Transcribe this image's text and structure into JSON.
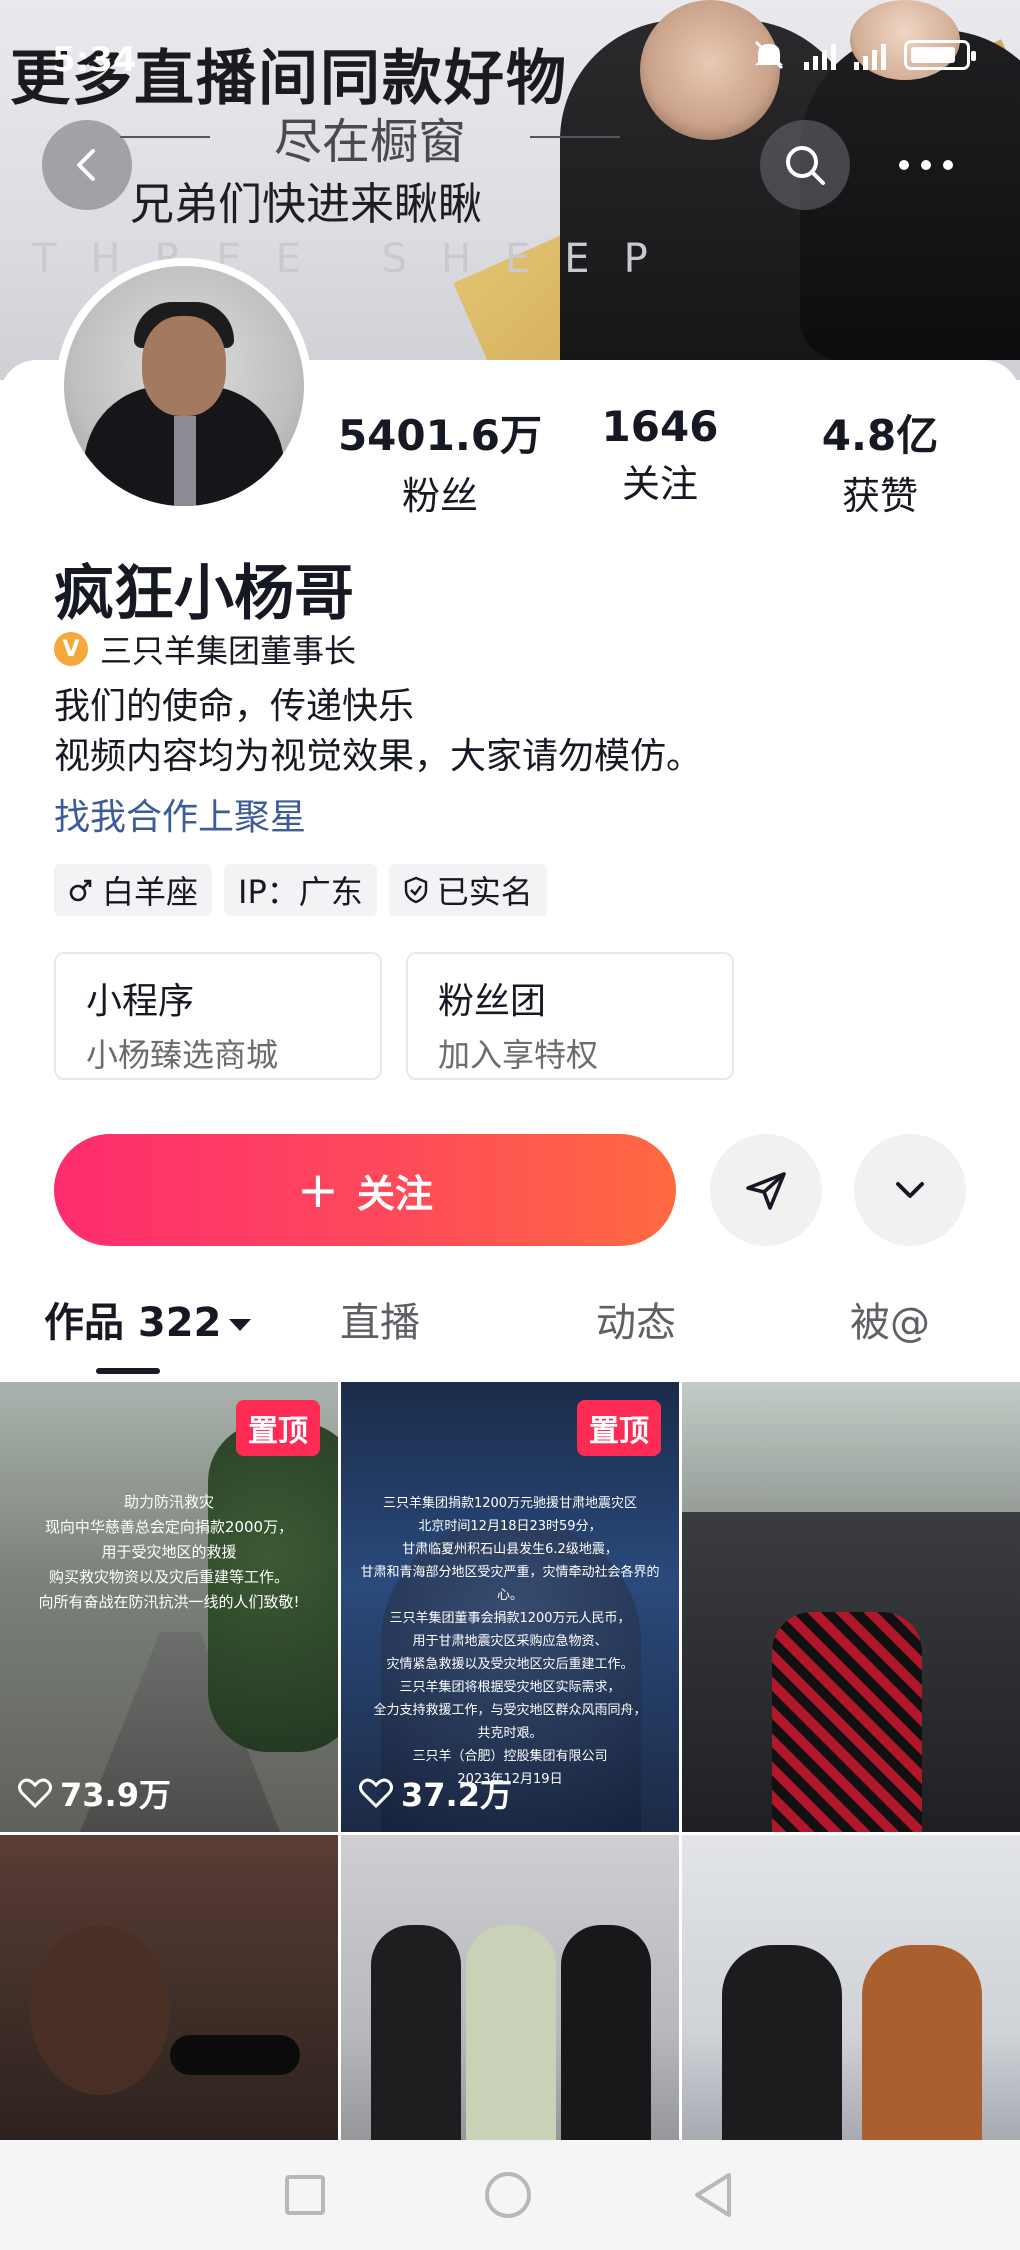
{
  "banner": {
    "headline": "更多直播间同款好物",
    "subtitle": "尽在橱窗",
    "subtitle2": "兄弟们快进来瞅瞅",
    "watermark": "THREE SHEEP"
  },
  "status_bar": {
    "time": "5:34"
  },
  "profile": {
    "stats": [
      {
        "value": "5401.6万",
        "label": "粉丝"
      },
      {
        "value": "1646",
        "label": "关注"
      },
      {
        "value": "4.8亿",
        "label": "获赞"
      }
    ],
    "name": "疯狂小杨哥",
    "verify_badge": "V",
    "verified_title": "三只羊集团董事长",
    "bio_line1": "我们的使命，传递快乐",
    "bio_line2": "视频内容均为视觉效果，大家请勿模仿。",
    "collab_link": "找我合作上聚星",
    "tags": [
      {
        "icon": "male-icon",
        "label": "白羊座"
      },
      {
        "label": "IP：广东"
      },
      {
        "icon": "shield-check-icon",
        "label": "已实名"
      }
    ],
    "mini_cards": [
      {
        "title": "小程序",
        "subtitle": "小杨臻选商城"
      },
      {
        "title": "粉丝团",
        "subtitle": "加入享特权"
      }
    ],
    "follow_plus": "+",
    "follow_label": "关注"
  },
  "tabs": [
    {
      "label": "作品 322",
      "active": true
    },
    {
      "label": "直播"
    },
    {
      "label": "动态"
    },
    {
      "label": "被@"
    }
  ],
  "grid": {
    "tiles": [
      {
        "pinned": "置顶",
        "likes": "73.9万",
        "caption": [
          "助力防汛救灾",
          "现向中华慈善总会定向捐款2000万，",
          "用于受灾地区的救援",
          "购买救灾物资以及灾后重建等工作。",
          "向所有奋战在防汛抗洪一线的人们致敬!"
        ]
      },
      {
        "pinned": "置顶",
        "likes": "37.2万",
        "caption": [
          "三只羊集团捐款1200万元驰援甘肃地震灾区",
          "北京时间12月18日23时59分，",
          "甘肃临夏州积石山县发生6.2级地震，",
          "甘肃和青海部分地区受灾严重，灾情牵动社会各界的心。",
          "三只羊集团董事会捐款1200万元人民币，",
          "用于甘肃地震灾区采购应急物资、",
          "灾情紧急救援以及受灾地区灾后重建工作。",
          "三只羊集团将根据受灾地区实际需求，",
          "全力支持救援工作，与受灾地区群众风雨同舟，",
          "共克时艰。",
          "三只羊（合肥）控股集团有限公司",
          "2023年12月19日"
        ]
      },
      {},
      {},
      {},
      {}
    ]
  },
  "colors": {
    "accent": "#fe2c55",
    "follow_gradient_start": "#fe2c6e",
    "follow_gradient_end": "#fe6a40",
    "link": "#3d5a99",
    "verify_badge": "#f3a93b"
  }
}
